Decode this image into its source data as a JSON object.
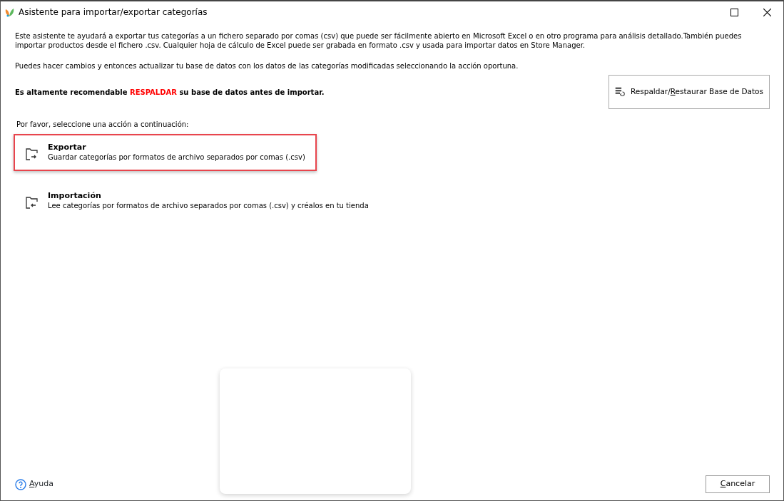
{
  "window": {
    "title": "Asistente para importar/exportar categorías"
  },
  "intro": [
    "Este asistente te ayudará a exportar tus categorías a un fichero separado por comas (csv) que puede ser fácilmente abierto en Microsoft Excel o en otro programa para análisis detallado.También puedes importar productos desde el fichero .csv. Cualquier hoja de cálculo de Excel puede ser grabada en formato .csv y usada para importar datos en Store Manager.",
    "Puedes hacer cambios y entonces actualizar tu base de datos con los datos de las categorías modificadas seleccionando la acción oportuna."
  ],
  "warning": [
    {
      "text": "Es altamente recomendable ",
      "highlighted": false
    },
    {
      "text": "RESPALDAR",
      "highlighted": true
    },
    {
      "text": " su base de datos antes de importar.",
      "highlighted": false
    }
  ],
  "backup_button": {
    "label": [
      {
        "text": "Respaldar/",
        "underlined": false
      },
      {
        "text": "R",
        "underlined": true
      },
      {
        "text": "estaurar Base de Datos",
        "underlined": false
      }
    ]
  },
  "prompt": "Por favor, seleccione una acción a continuación:",
  "actions": [
    {
      "kind": "export",
      "title": "Exportar",
      "description": "Guardar categorías por formatos de archivo separados por comas (.csv)",
      "selected": true
    },
    {
      "kind": "import",
      "title": "Importación",
      "description": "Lee categorías por formatos de archivo separados por comas (.csv) y créalos en tu tienda",
      "selected": false
    }
  ],
  "help_link": {
    "label": [
      {
        "text": "A",
        "underlined": true
      },
      {
        "text": "yuda",
        "underlined": false
      }
    ]
  },
  "cancel_button": {
    "label": [
      {
        "text": "C",
        "underlined": true
      },
      {
        "text": "ancelar",
        "underlined": false
      }
    ]
  }
}
